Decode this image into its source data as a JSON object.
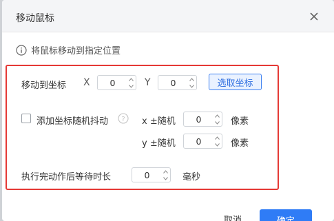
{
  "dialog": {
    "title": "移动鼠标",
    "close_icon": "close-icon"
  },
  "hint": {
    "icon": "info-icon",
    "text": "将鼠标移动到指定位置"
  },
  "move_to": {
    "label": "移动到坐标",
    "x_label": "X",
    "x_value": "0",
    "y_label": "Y",
    "y_value": "0",
    "pick_button": "选取坐标"
  },
  "jitter": {
    "checkbox_label": "添加坐标随机抖动",
    "checked": false,
    "help_icon": "question-icon",
    "x_label": "x ±随机",
    "x_value": "0",
    "x_unit": "像素",
    "y_label": "y ±随机",
    "y_value": "0",
    "y_unit": "像素"
  },
  "wait": {
    "label": "执行完动作后等待时长",
    "value": "0",
    "unit": "毫秒"
  },
  "footer": {
    "cancel": "取消",
    "ok": "确定"
  }
}
